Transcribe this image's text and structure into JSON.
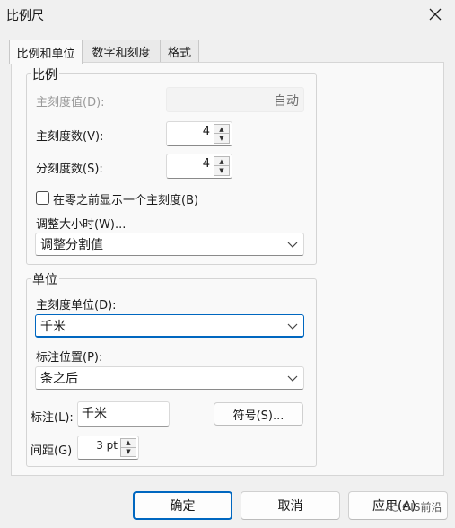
{
  "window": {
    "title": "比例尺",
    "close_icon": "close-icon"
  },
  "tabs": [
    {
      "label": "比例和单位",
      "active": true
    },
    {
      "label": "数字和刻度",
      "active": false
    },
    {
      "label": "格式",
      "active": false
    }
  ],
  "ratio_group": {
    "legend": "比例",
    "major_value_label": "主刻度值(D):",
    "major_value": "自动",
    "major_count_label": "主刻度数(V):",
    "major_count": "4",
    "minor_count_label": "分刻度数(S):",
    "minor_count": "4",
    "show_before_zero_label": "在零之前显示一个主刻度(B)",
    "show_before_zero_checked": false,
    "resize_label": "调整大小时(W)...",
    "resize_value": "调整分割值"
  },
  "units_group": {
    "legend": "单位",
    "major_unit_label": "主刻度单位(D):",
    "major_unit_value": "千米",
    "label_pos_label": "标注位置(P):",
    "label_pos_value": "条之后",
    "label_label": "标注(L):",
    "label_value": "千米",
    "symbol_button": "符号(S)...",
    "gap_label": "间距(G)",
    "gap_value": "3 pt"
  },
  "buttons": {
    "ok": "确定",
    "cancel": "取消",
    "apply": "应用(A)"
  },
  "watermark": "GIS前沿",
  "colors": {
    "accent": "#0067c0",
    "background": "#f0f0f0",
    "panel": "#f9f9f9"
  }
}
